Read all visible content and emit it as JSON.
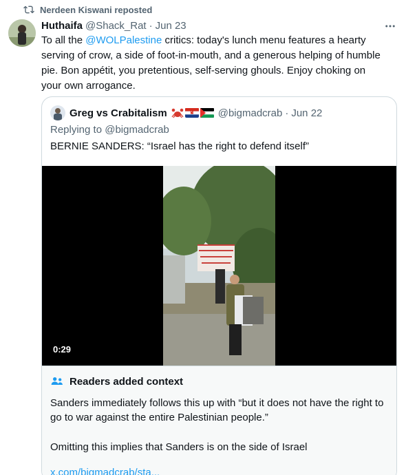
{
  "repost": {
    "label": "Nerdeen Kiswani reposted",
    "icon": "repost-icon"
  },
  "tweet": {
    "name": "Huthaifa",
    "handle": "@Shack_Rat",
    "separator": "·",
    "date": "Jun 23",
    "text_before": "To all the ",
    "mention": "@WOLPalestine",
    "text_after": " critics: today's lunch menu features a hearty serving of crow, a side of foot-in-mouth, and a generous helping of humble pie. Bon appétit, you pretentious, self-serving ghouls. Enjoy choking on your own arrogance.",
    "more_icon": "more-icon"
  },
  "quote": {
    "name": "Greg vs Crabitalism",
    "emoji": [
      "crab",
      "croatia-flag",
      "palestine-flag"
    ],
    "handle": "@bigmadcrab",
    "separator": "·",
    "date": "Jun 22",
    "replying_prefix": "Replying to ",
    "replying_to": "@bigmadcrab",
    "text": "BERNIE SANDERS: “Israel has the right to defend itself”",
    "video_duration": "0:29"
  },
  "context": {
    "title": "Readers added context",
    "icon": "people-icon",
    "body1": "Sanders immediately follows this up with “but it does not have the right to go to war against the entire Palestinian people.”",
    "body2": "Omitting this implies that Sanders is on the side of Israel",
    "link": "x.com/bigmadcrab/sta..."
  },
  "colors": {
    "accent": "#1d9bf0",
    "muted": "#536471",
    "border": "#cfd9de",
    "context_bg": "#f7f9f9"
  }
}
